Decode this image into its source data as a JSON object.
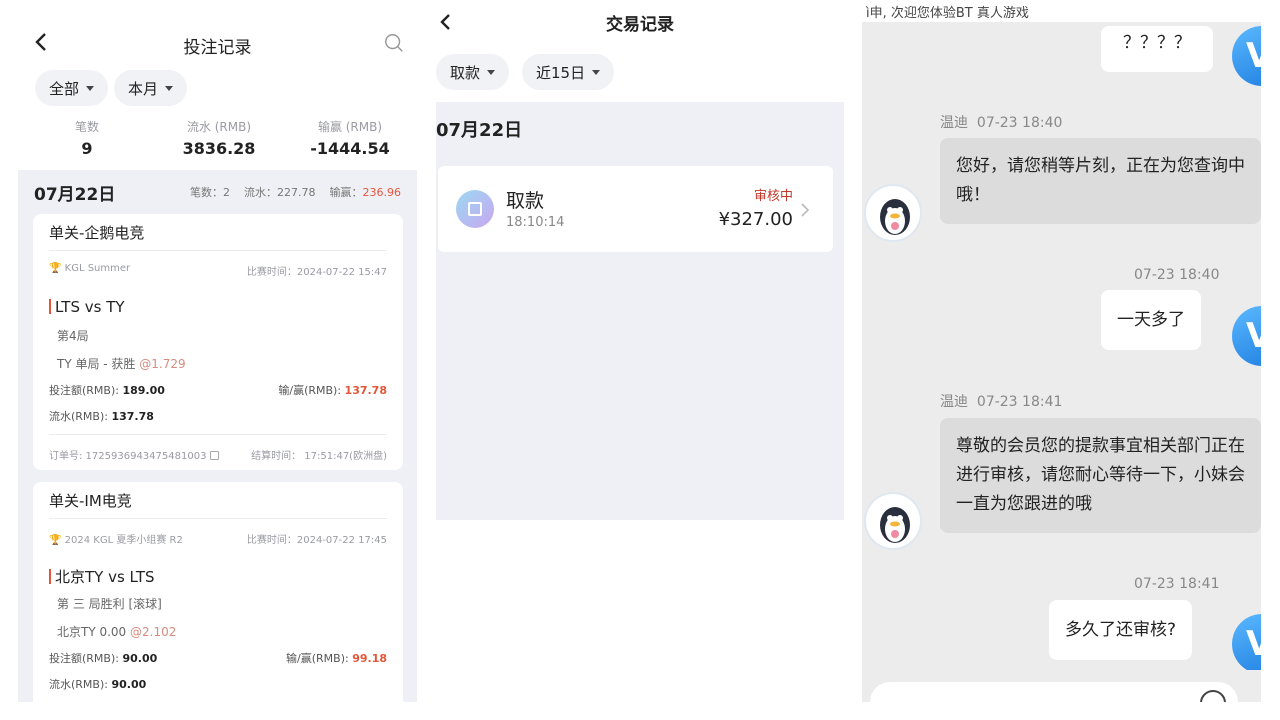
{
  "bet_records": {
    "title": "投注记录",
    "filters": [
      "全部",
      "本月"
    ],
    "stats": [
      {
        "label": "笔数",
        "value": "9"
      },
      {
        "label": "流水 (RMB)",
        "value": "3836.28"
      },
      {
        "label": "输赢 (RMB)",
        "value": "-1444.54"
      }
    ],
    "day": {
      "date": "07月22日",
      "count_label": "笔数：",
      "count": "2",
      "flow_label": "流水：",
      "flow": "227.78",
      "winloss_label": "输赢：",
      "winloss": "236.96"
    },
    "cards": [
      {
        "title": "单关-企鹅电竞",
        "league": "KGL Summer",
        "match_time": "比赛时间：2024-07-22 15:47",
        "match": "LTS vs TY",
        "round": "第4局",
        "pick": "TY 单局 - 获胜 ",
        "odds": "@1.729",
        "stake_label": "投注额(RMB): ",
        "stake": "189.00",
        "result_label": "输/赢(RMB): ",
        "result": "137.78",
        "flow_label": "流水(RMB): ",
        "flow": "137.78",
        "order": "订单号: 1725936943475481003",
        "settle": "结算时间： 17:51:47(欧洲盘)"
      },
      {
        "title": "单关-IM电竞",
        "league": "2024 KGL 夏季小组赛 R2",
        "match_time": "比赛时间：2024-07-22 17:45",
        "match": "北京TY vs LTS",
        "round": "第 三 局胜利 [滚球]",
        "pick": "北京TY 0.00 ",
        "odds": "@2.102",
        "stake_label": "投注额(RMB): ",
        "stake": "90.00",
        "result_label": "输/赢(RMB): ",
        "result": "99.18",
        "flow_label": "流水(RMB): ",
        "flow": "90.00"
      }
    ]
  },
  "transactions": {
    "title": "交易记录",
    "filters": [
      "取款",
      "近15日"
    ],
    "date": "07月22日",
    "item": {
      "type": "取款",
      "time": "18:10:14",
      "status": "审核中",
      "amount": "¥327.00"
    }
  },
  "chat": {
    "top_text": "ì申, 次迎您体验BT 真人游戏",
    "messages": [
      {
        "side": "right",
        "text": "？？？？"
      },
      {
        "side": "left",
        "sender": "温迪",
        "time": "07-23 18:40",
        "text": "您好，请您稍等片刻，正在为您查询中哦！"
      },
      {
        "side": "right",
        "time": "07-23 18:40",
        "text": "一天多了"
      },
      {
        "side": "left",
        "sender": "温迪",
        "time": "07-23 18:41",
        "text": "尊敬的会员您的提款事宜相关部门正在进行审核，请您耐心等待一下，小妹会一直为您跟进的哦"
      },
      {
        "side": "right",
        "time": "07-23 18:41",
        "text": "多久了还审核?"
      }
    ]
  },
  "icons": {
    "back": "chevron-left-icon",
    "search": "search-icon",
    "caret": "caret-down-icon",
    "trophy": "trophy-icon",
    "copy": "copy-icon",
    "withdraw": "wallet-icon",
    "chevron_right": "chevron-right-icon",
    "emoji": "emoji-icon"
  },
  "colors": {
    "accent_red": "#e4563b",
    "status_red": "#c0392b",
    "bg_grey": "#eef0f5"
  }
}
